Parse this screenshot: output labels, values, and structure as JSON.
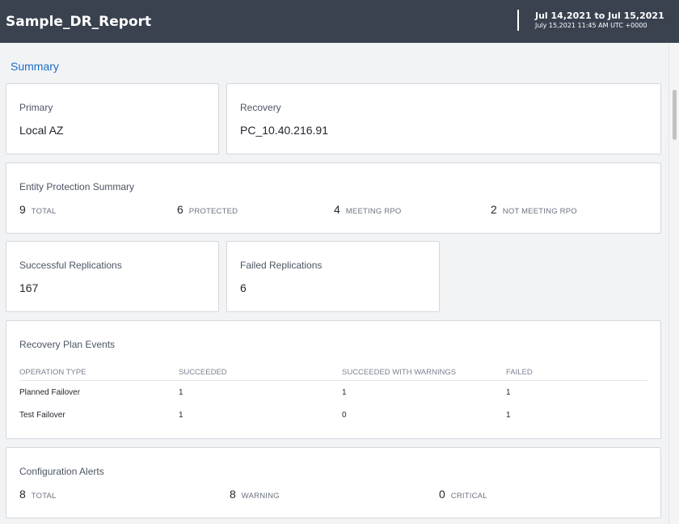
{
  "header": {
    "title": "Sample_DR_Report",
    "date_range": "Jul 14,2021 to Jul 15,2021",
    "generated": "July 15,2021 11:45 AM UTC +0000"
  },
  "summary_title": "Summary",
  "primary": {
    "label": "Primary",
    "value": "Local AZ"
  },
  "recovery": {
    "label": "Recovery",
    "value": "PC_10.40.216.91"
  },
  "entity_protection": {
    "label": "Entity Protection Summary",
    "stats": [
      {
        "value": "9",
        "label": "TOTAL"
      },
      {
        "value": "6",
        "label": "PROTECTED"
      },
      {
        "value": "4",
        "label": "MEETING RPO"
      },
      {
        "value": "2",
        "label": "NOT MEETING RPO"
      }
    ]
  },
  "successful_replications": {
    "label": "Successful Replications",
    "value": "167"
  },
  "failed_replications": {
    "label": "Failed Replications",
    "value": "6"
  },
  "recovery_plan_events": {
    "label": "Recovery Plan Events",
    "columns": [
      "OPERATION TYPE",
      "SUCCEEDED",
      "SUCCEEDED WITH WARNINGS",
      "FAILED"
    ],
    "rows": [
      [
        "Planned Failover",
        "1",
        "1",
        "1"
      ],
      [
        "Test Failover",
        "1",
        "0",
        "1"
      ]
    ]
  },
  "configuration_alerts": {
    "label": "Configuration Alerts",
    "stats": [
      {
        "value": "8",
        "label": "TOTAL"
      },
      {
        "value": "8",
        "label": "WARNING"
      },
      {
        "value": "0",
        "label": "CRITICAL"
      }
    ]
  }
}
